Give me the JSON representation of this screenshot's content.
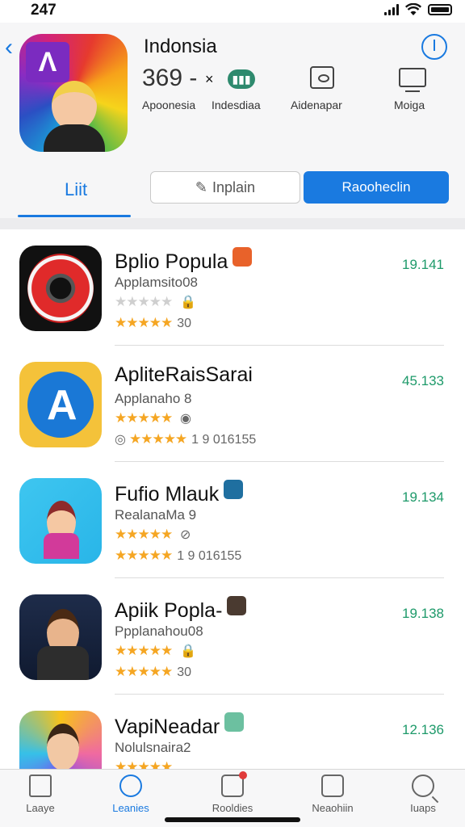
{
  "status": {
    "time": "247"
  },
  "header": {
    "title": "Indonsia",
    "stats": {
      "big": "369 -",
      "x": "×",
      "labels": [
        "Apoonesia",
        "Indesdiaa",
        "Aidenapar",
        "Moiga"
      ]
    },
    "segment_label": "Liit",
    "btn_outline": "Inplain",
    "btn_fill": "Raooheclin"
  },
  "apps": [
    {
      "name": "Bplio Popula",
      "sub": "Applamsito08",
      "stars1": "★★★★★",
      "meta1": "",
      "stars2": "★★★★★",
      "meta2": "30",
      "price": "19.141",
      "tag_color": "#e8622a"
    },
    {
      "name": "ApliteRaisSarai",
      "sub": "Applanaho 8",
      "stars1": "★★★★★",
      "meta1": "",
      "stars2": "★★★★★",
      "meta2": "1 9 016155",
      "price": "45.133",
      "tag_color": ""
    },
    {
      "name": "Fufio Mlauk",
      "sub": "RealanaMa 9",
      "stars1": "★★★★★",
      "meta1": "",
      "stars2": "★★★★★",
      "meta2": "1 9 016155",
      "price": "19.134",
      "tag_color": "#1f6fa0"
    },
    {
      "name": "Apiik Popla-",
      "sub": "Ppplanahou08",
      "stars1": "★★★★★",
      "meta1": "",
      "stars2": "★★★★★",
      "meta2": "30",
      "price": "19.138",
      "tag_color": "#4a3a30"
    },
    {
      "name": "VapiNeadar",
      "sub": "Nolulsnaira2",
      "stars1": "★★★★★",
      "meta1": "",
      "stars2": "",
      "meta2": "",
      "price": "12.136",
      "tag_color": "#6cc0a0"
    }
  ],
  "tabbar": {
    "items": [
      "Laaye",
      "Leanies",
      "Rooldies",
      "Neaohiin",
      "Iuaps"
    ]
  },
  "colors": {
    "accent": "#1a7ae0",
    "price": "#1e9a6a",
    "star": "#f5a623"
  }
}
